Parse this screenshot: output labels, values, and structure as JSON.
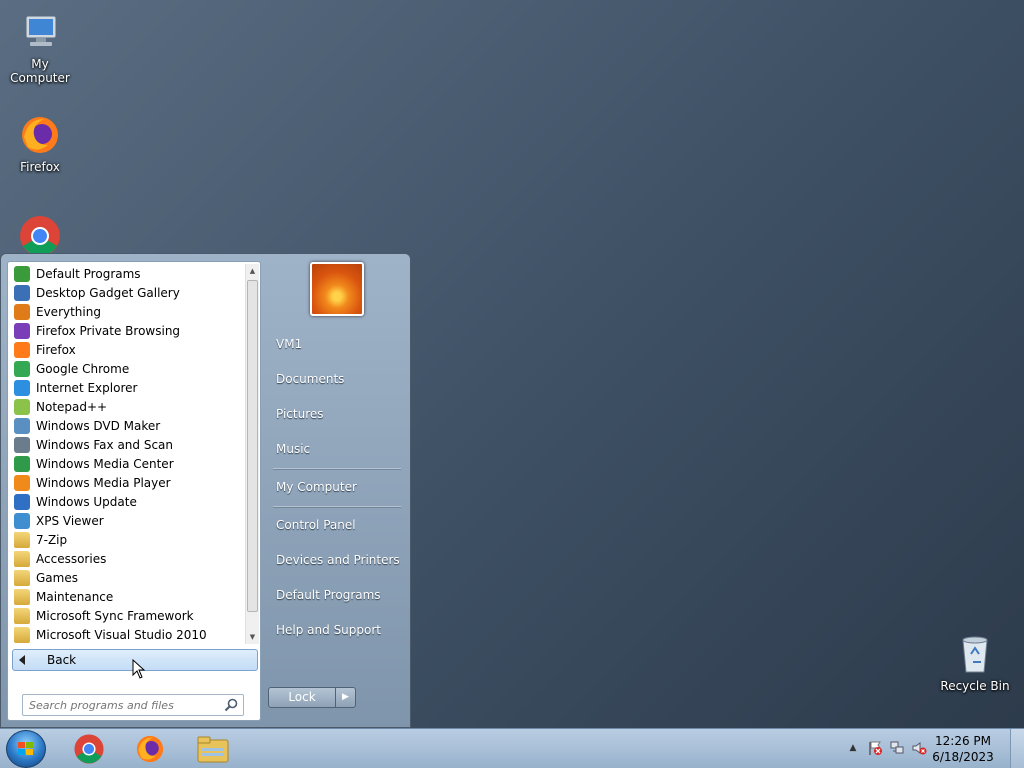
{
  "desktop": {
    "icons": [
      {
        "label": "My Computer",
        "icon": "computer-icon"
      },
      {
        "label": "Firefox",
        "icon": "firefox-icon"
      },
      {
        "label": "",
        "icon": "chrome-icon"
      },
      {
        "label": "Recycle Bin",
        "icon": "recycle-bin-icon"
      }
    ]
  },
  "start_menu": {
    "programs": [
      {
        "label": "Default Programs",
        "icon": "default-programs-icon",
        "color": "#3a9b3a"
      },
      {
        "label": "Desktop Gadget Gallery",
        "icon": "gadget-gallery-icon",
        "color": "#3b6fb6"
      },
      {
        "label": "Everything",
        "icon": "everything-icon",
        "color": "#e07b1a"
      },
      {
        "label": "Firefox Private Browsing",
        "icon": "firefox-private-icon",
        "color": "#7a3fb8"
      },
      {
        "label": "Firefox",
        "icon": "firefox-icon",
        "color": "#ff7a18"
      },
      {
        "label": "Google Chrome",
        "icon": "chrome-icon",
        "color": "#34a853"
      },
      {
        "label": "Internet Explorer",
        "icon": "ie-icon",
        "color": "#2d8fe0"
      },
      {
        "label": "Notepad++",
        "icon": "notepad-plus-plus-icon",
        "color": "#8bc34a"
      },
      {
        "label": "Windows DVD Maker",
        "icon": "dvd-maker-icon",
        "color": "#5a8fc2"
      },
      {
        "label": "Windows Fax and Scan",
        "icon": "fax-scan-icon",
        "color": "#6b7c8c"
      },
      {
        "label": "Windows Media Center",
        "icon": "media-center-icon",
        "color": "#2e9a4a"
      },
      {
        "label": "Windows Media Player",
        "icon": "media-player-icon",
        "color": "#f08a1a"
      },
      {
        "label": "Windows Update",
        "icon": "windows-update-icon",
        "color": "#2f6fc4"
      },
      {
        "label": "XPS Viewer",
        "icon": "xps-viewer-icon",
        "color": "#3f8fd0"
      },
      {
        "label": "7-Zip",
        "icon": "folder-icon",
        "color": "folder"
      },
      {
        "label": "Accessories",
        "icon": "folder-icon",
        "color": "folder"
      },
      {
        "label": "Games",
        "icon": "folder-icon",
        "color": "folder"
      },
      {
        "label": "Maintenance",
        "icon": "folder-icon",
        "color": "folder"
      },
      {
        "label": "Microsoft Sync Framework",
        "icon": "folder-icon",
        "color": "folder"
      },
      {
        "label": "Microsoft Visual Studio 2010",
        "icon": "folder-icon",
        "color": "folder"
      }
    ],
    "back_label": "Back",
    "search_placeholder": "Search programs and files",
    "right_links": [
      {
        "label": "VM1"
      },
      {
        "label": "Documents"
      },
      {
        "label": "Pictures"
      },
      {
        "label": "Music"
      },
      {
        "label": "My Computer"
      },
      {
        "label": "Control Panel"
      },
      {
        "label": "Devices and Printers"
      },
      {
        "label": "Default Programs"
      },
      {
        "label": "Help and Support"
      }
    ],
    "lock_label": "Lock",
    "lock_arrow": "▶"
  },
  "taskbar": {
    "pinned": [
      {
        "icon": "chrome-icon"
      },
      {
        "icon": "firefox-icon"
      },
      {
        "icon": "file-explorer-icon"
      }
    ],
    "tray_icons": [
      "show-hidden-icons-chevron",
      "action-center-flag-icon",
      "network-icon",
      "volume-muted-icon"
    ],
    "clock_time": "12:26 PM",
    "clock_date": "6/18/2023"
  }
}
